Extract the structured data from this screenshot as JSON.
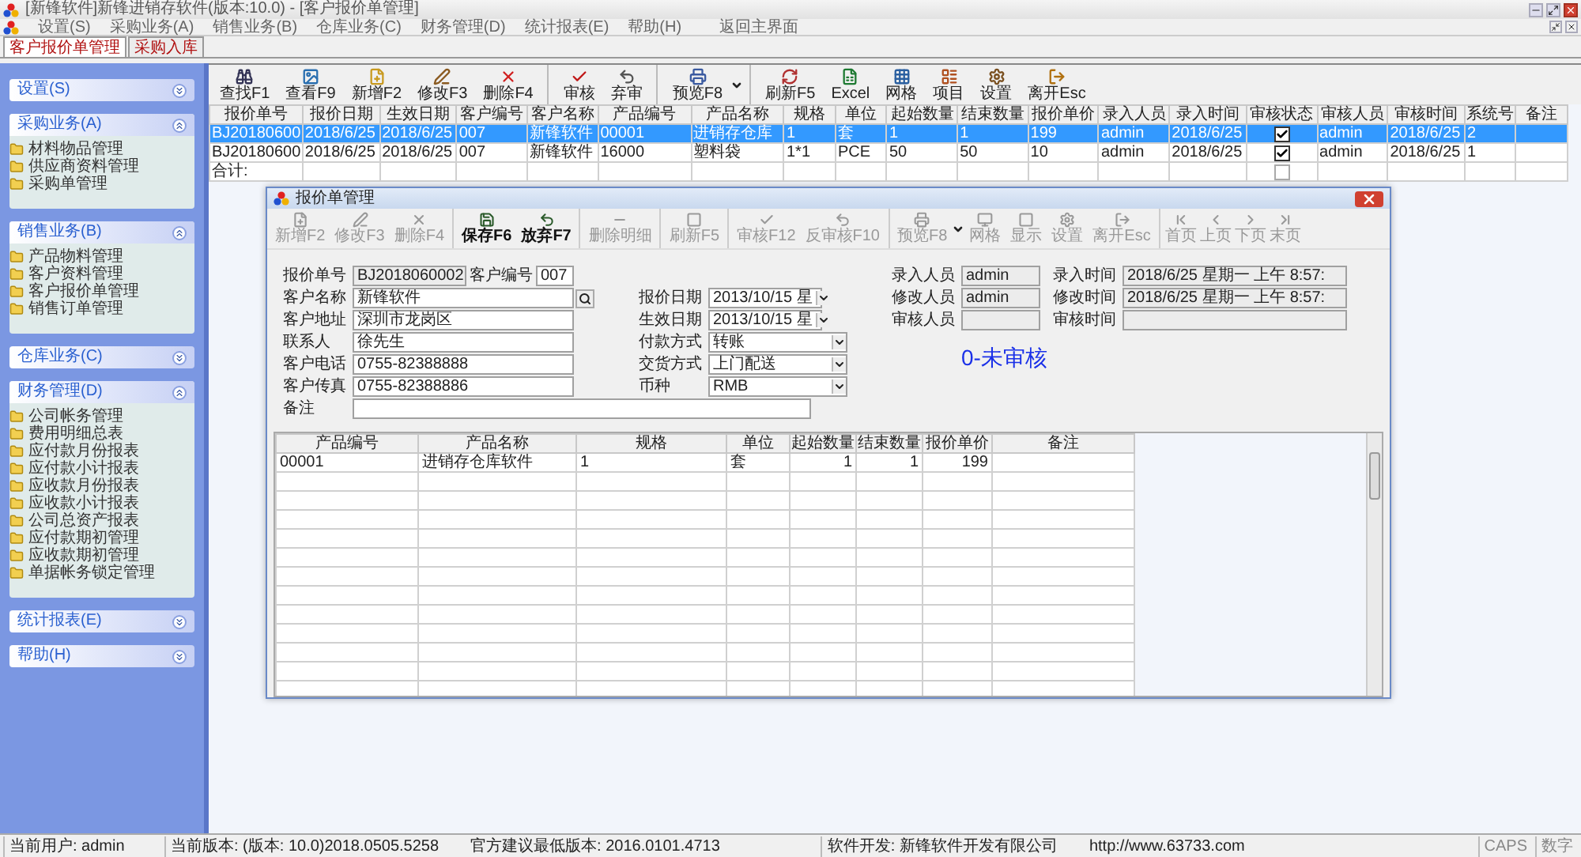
{
  "window": {
    "title": "[新锋软件]新锋进销存软件(版本:10.0) - [客户报价单管理]"
  },
  "menu": [
    {
      "label": "设置(S)"
    },
    {
      "label": "采购业务(A)"
    },
    {
      "label": "销售业务(B)"
    },
    {
      "label": "仓库业务(C)"
    },
    {
      "label": "财务管理(D)"
    },
    {
      "label": "统计报表(E)"
    },
    {
      "label": "帮助(H)"
    },
    {
      "label": "返回主界面"
    }
  ],
  "doc_tabs": [
    {
      "label": "客户报价单管理",
      "selected": true
    },
    {
      "label": "采购入库",
      "selected": false
    }
  ],
  "sidebar": [
    {
      "title": "设置(S)",
      "expanded": false
    },
    {
      "title": "采购业务(A)",
      "expanded": true,
      "items": [
        "材料物品管理",
        "供应商资料管理",
        "采购单管理"
      ]
    },
    {
      "title": "销售业务(B)",
      "expanded": true,
      "items": [
        "产品物料管理",
        "客户资料管理",
        "客户报价单管理",
        "销售订单管理"
      ]
    },
    {
      "title": "仓库业务(C)",
      "expanded": false
    },
    {
      "title": "财务管理(D)",
      "expanded": true,
      "items": [
        "公司帐务管理",
        "费用明细总表",
        "应付款月份报表",
        "应付款小计报表",
        "应收款月份报表",
        "应收款小计报表",
        "公司总资产报表",
        "应付款期初管理",
        "应收款期初管理",
        "单据帐务锁定管理"
      ]
    },
    {
      "title": "统计报表(E)",
      "expanded": false
    },
    {
      "title": "帮助(H)",
      "expanded": false
    }
  ],
  "toolbar": [
    {
      "label": "查找F1",
      "separator_before": false,
      "dropdown": false
    },
    {
      "label": "查看F9",
      "separator_before": false,
      "dropdown": false
    },
    {
      "label": "新增F2",
      "separator_before": false,
      "dropdown": false
    },
    {
      "label": "修改F3",
      "separator_before": false,
      "dropdown": false
    },
    {
      "label": "删除F4",
      "separator_before": false,
      "dropdown": false
    },
    {
      "label": "审核",
      "separator_before": true,
      "dropdown": false
    },
    {
      "label": "弃审",
      "separator_before": false,
      "dropdown": false
    },
    {
      "label": "预览F8",
      "separator_before": true,
      "dropdown": true
    },
    {
      "label": "刷新F5",
      "separator_before": true,
      "dropdown": false
    },
    {
      "label": "Excel",
      "separator_before": false,
      "dropdown": false
    },
    {
      "label": "网格",
      "separator_before": false,
      "dropdown": false
    },
    {
      "label": "项目",
      "separator_before": false,
      "dropdown": false
    },
    {
      "label": "设置",
      "separator_before": false,
      "dropdown": false
    },
    {
      "label": "离开Esc",
      "separator_before": false,
      "dropdown": false
    }
  ],
  "table": {
    "columns": [
      {
        "label": "报价单号",
        "kind": "id"
      },
      {
        "label": "报价日期",
        "kind": "date"
      },
      {
        "label": "生效日期",
        "kind": "date"
      },
      {
        "label": "客户编号",
        "kind": "text"
      },
      {
        "label": "客户名称",
        "kind": "text"
      },
      {
        "label": "产品编号",
        "kind": "wide"
      },
      {
        "label": "产品名称",
        "kind": "wide"
      },
      {
        "label": "规格",
        "kind": "narrow"
      },
      {
        "label": "单位",
        "kind": "narrow"
      },
      {
        "label": "起始数量",
        "kind": "text"
      },
      {
        "label": "结束数量",
        "kind": "text"
      },
      {
        "label": "报价单价",
        "kind": "text"
      },
      {
        "label": "录入人员",
        "kind": "text"
      },
      {
        "label": "录入时间",
        "kind": "date"
      },
      {
        "label": "审核状态",
        "kind": "check"
      },
      {
        "label": "审核人员",
        "kind": "text"
      },
      {
        "label": "审核时间",
        "kind": "date"
      },
      {
        "label": "系统号",
        "kind": "narrow"
      },
      {
        "label": "备注",
        "kind": "narrow"
      }
    ],
    "rows": [
      {
        "selected": true,
        "checked": true,
        "cells": [
          "BJ20180600",
          "2018/6/25",
          "2018/6/25",
          "007",
          "新锋软件",
          "00001",
          "进销存仓库",
          "1",
          "套",
          "1",
          "1",
          "199",
          "admin",
          "2018/6/25",
          "",
          "admin",
          "2018/6/25",
          "2",
          ""
        ]
      },
      {
        "selected": false,
        "checked": true,
        "cells": [
          "BJ20180600",
          "2018/6/25",
          "2018/6/25",
          "007",
          "新锋软件",
          "16000",
          "塑料袋",
          "1*1",
          "PCE",
          "50",
          "50",
          "10",
          "admin",
          "2018/6/25",
          "",
          "admin",
          "2018/6/25",
          "1",
          ""
        ]
      },
      {
        "selected": false,
        "checked": false,
        "cells": [
          "合计:"
        ]
      }
    ]
  },
  "dialog": {
    "title": "报价单管理",
    "toolbar": [
      {
        "label": "新增F2",
        "disabled": true,
        "separator_before": false,
        "dropdown": false,
        "kind": "tool"
      },
      {
        "label": "修改F3",
        "disabled": true,
        "separator_before": false,
        "dropdown": false,
        "kind": "tool"
      },
      {
        "label": "删除F4",
        "disabled": true,
        "separator_before": false,
        "dropdown": false,
        "kind": "tool"
      },
      {
        "label": "保存F6",
        "disabled": false,
        "separator_before": true,
        "dropdown": false,
        "kind": "tool"
      },
      {
        "label": "放弃F7",
        "disabled": false,
        "separator_before": false,
        "dropdown": false,
        "kind": "tool"
      },
      {
        "label": "删除明细",
        "disabled": true,
        "separator_before": true,
        "dropdown": false,
        "kind": "tool"
      },
      {
        "label": "刷新F5",
        "disabled": true,
        "separator_before": true,
        "dropdown": false,
        "kind": "tool"
      },
      {
        "label": "审核F12",
        "disabled": true,
        "separator_before": true,
        "dropdown": false,
        "kind": "tool"
      },
      {
        "label": "反审核F10",
        "disabled": true,
        "separator_before": false,
        "dropdown": false,
        "kind": "tool"
      },
      {
        "label": "预览F8",
        "disabled": true,
        "separator_before": true,
        "dropdown": true,
        "kind": "tool"
      },
      {
        "label": "网格",
        "disabled": true,
        "separator_before": false,
        "dropdown": false,
        "kind": "tool"
      },
      {
        "label": "显示",
        "disabled": true,
        "separator_before": false,
        "dropdown": false,
        "kind": "tool"
      },
      {
        "label": "设置",
        "disabled": true,
        "separator_before": false,
        "dropdown": false,
        "kind": "tool"
      },
      {
        "label": "离开Esc",
        "disabled": true,
        "separator_before": false,
        "dropdown": false,
        "kind": "tool"
      },
      {
        "label": "首页",
        "disabled": true,
        "separator_before": true,
        "dropdown": false,
        "kind": "nav"
      },
      {
        "label": "上页",
        "disabled": true,
        "separator_before": false,
        "dropdown": false,
        "kind": "nav"
      },
      {
        "label": "下页",
        "disabled": true,
        "separator_before": false,
        "dropdown": false,
        "kind": "nav"
      },
      {
        "label": "末页",
        "disabled": true,
        "separator_before": false,
        "dropdown": false,
        "kind": "nav"
      }
    ],
    "left_fields": [
      {
        "kind": "pair",
        "label": "报价单号",
        "value": "BJ2018060002",
        "readonly": true,
        "label2": "客户编号",
        "value2": "007"
      },
      {
        "kind": "lookup",
        "label": "客户名称",
        "value": "新锋软件",
        "readonly": false
      },
      {
        "kind": "text",
        "label": "客户地址",
        "value": "深圳市龙岗区",
        "readonly": false
      },
      {
        "kind": "text",
        "label": "联系人",
        "value": "徐先生",
        "readonly": false
      },
      {
        "kind": "text",
        "label": "客户电话",
        "value": "0755-82388888",
        "readonly": false
      },
      {
        "kind": "text",
        "label": "客户传真",
        "value": "0755-82388886",
        "readonly": false
      }
    ],
    "middle_fields": [
      {
        "kind": "date",
        "label": "报价日期",
        "value": "2013/10/15 星"
      },
      {
        "kind": "date",
        "label": "生效日期",
        "value": "2013/10/15 星"
      },
      {
        "kind": "select",
        "label": "付款方式",
        "value": "转账"
      },
      {
        "kind": "select",
        "label": "交货方式",
        "value": "上门配送"
      },
      {
        "kind": "select",
        "label": "币种",
        "value": "RMB"
      }
    ],
    "remark": {
      "label": "备注"
    },
    "right_fields": [
      {
        "label": "录入人员",
        "value": "admin",
        "label2": "录入时间",
        "value2": "2018/6/25 星期一 上午 8:57:"
      },
      {
        "label": "修改人员",
        "value": "admin",
        "label2": "修改时间",
        "value2": "2018/6/25 星期一 上午 8:57:"
      },
      {
        "label": "审核人员",
        "label2": "审核时间"
      }
    ],
    "status_text": "0-未审核",
    "grid": {
      "columns": [
        {
          "label": "产品编号",
          "kind": "text"
        },
        {
          "label": "产品名称",
          "kind": "text"
        },
        {
          "label": "规格",
          "kind": "text"
        },
        {
          "label": "单位",
          "kind": "text"
        },
        {
          "label": "起始数量",
          "kind": "number"
        },
        {
          "label": "结束数量",
          "kind": "number"
        },
        {
          "label": "报价单价",
          "kind": "number"
        },
        {
          "label": "备注",
          "kind": "text"
        }
      ],
      "rows": [
        {
          "cells": [
            "00001",
            "进销存仓库软件",
            "1",
            "套",
            "1",
            "1",
            "199",
            ""
          ]
        }
      ]
    }
  },
  "status_bar": [
    {
      "kind": "segment",
      "texts": [
        "当前用户: admin"
      ]
    },
    {
      "kind": "segment",
      "texts": [
        "当前版本: (版本: 10.0)2018.0505.5258",
        "官方建议最低版本: 2016.0101.4713"
      ]
    },
    {
      "kind": "segment",
      "texts": [
        "软件开发: 新锋软件开发有限公司",
        "http://www.63733.com"
      ]
    },
    {
      "kind": "key",
      "texts": [
        "CAPS"
      ]
    },
    {
      "kind": "key",
      "texts": [
        "数字"
      ]
    }
  ]
}
